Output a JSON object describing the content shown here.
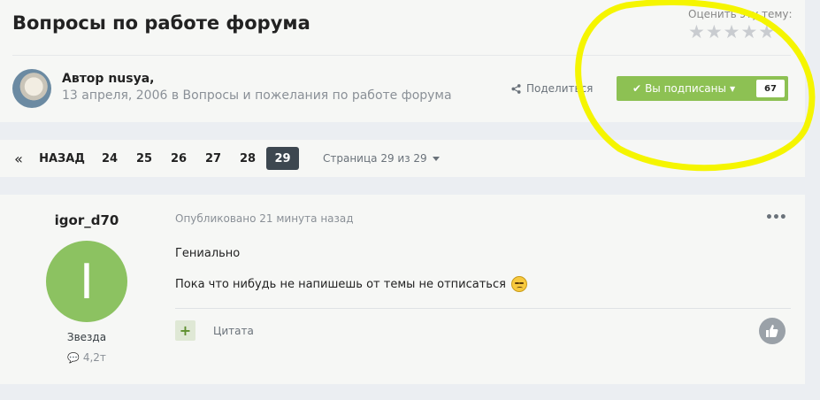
{
  "topic": {
    "title": "Вопросы по работе форума",
    "rating_label": "Оценить эту тему:",
    "rating_stars": 5,
    "rating_value": 0,
    "author_line": "Автор nusya,",
    "meta": "13 апреля, 2006 в Вопросы и пожелания по работе форума",
    "share_label": "Поделиться",
    "follow_label": "Вы подписаны",
    "follow_count": "67"
  },
  "pagination": {
    "first": "«",
    "prev": "НАЗАД",
    "pages": [
      "24",
      "25",
      "26",
      "27",
      "28"
    ],
    "current": "29",
    "info": "Страница 29 из 29"
  },
  "post": {
    "username": "igor_d70",
    "avatar_letter": "I",
    "rank": "Звезда",
    "post_count": "4,2т",
    "published": "Опубликовано 21 минута назад",
    "menu": "•••",
    "line1": "Гениально",
    "line2": "Пока что нибудь не напишешь от темы не отписаться",
    "plus": "+",
    "quote": "Цитата"
  },
  "colors": {
    "accent_green": "#8dc153",
    "avatar_green": "#8cc261",
    "active_page": "#3d4750",
    "highlight": "#f5f500"
  }
}
